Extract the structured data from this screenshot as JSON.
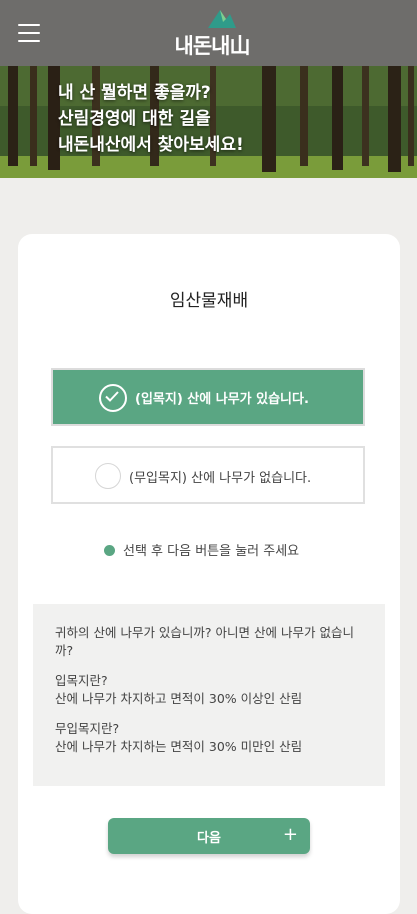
{
  "header": {
    "logo_text": "내돈내山"
  },
  "banner": {
    "line1": "내 산 뭘하면 좋을까?",
    "line2": "산림경영에 대한 길을",
    "line3": "내돈내산에서 찾아보세요!"
  },
  "card": {
    "title": "임산물재배",
    "option1": "(입목지) 산에 나무가 있습니다.",
    "option2": "(무입목지) 산에 나무가 없습니다.",
    "hint": "선택 후 다음 버튼을 눌러 주세요",
    "info": {
      "question": "귀하의 산에 나무가 있습니까? 아니면 산에 나무가 없습니까?",
      "def1_title": "입목지란?",
      "def1_body": "산에 나무가 차지하고 면적이 30% 이상인 산림",
      "def2_title": "무입목지란?",
      "def2_body": "산에 나무가 차지하는 면적이 30% 미만인 산림"
    },
    "next_label": "다음",
    "next_icon": "+"
  },
  "colors": {
    "accent": "#5aa683",
    "header": "#6e6d6b",
    "background": "#efeeec"
  }
}
